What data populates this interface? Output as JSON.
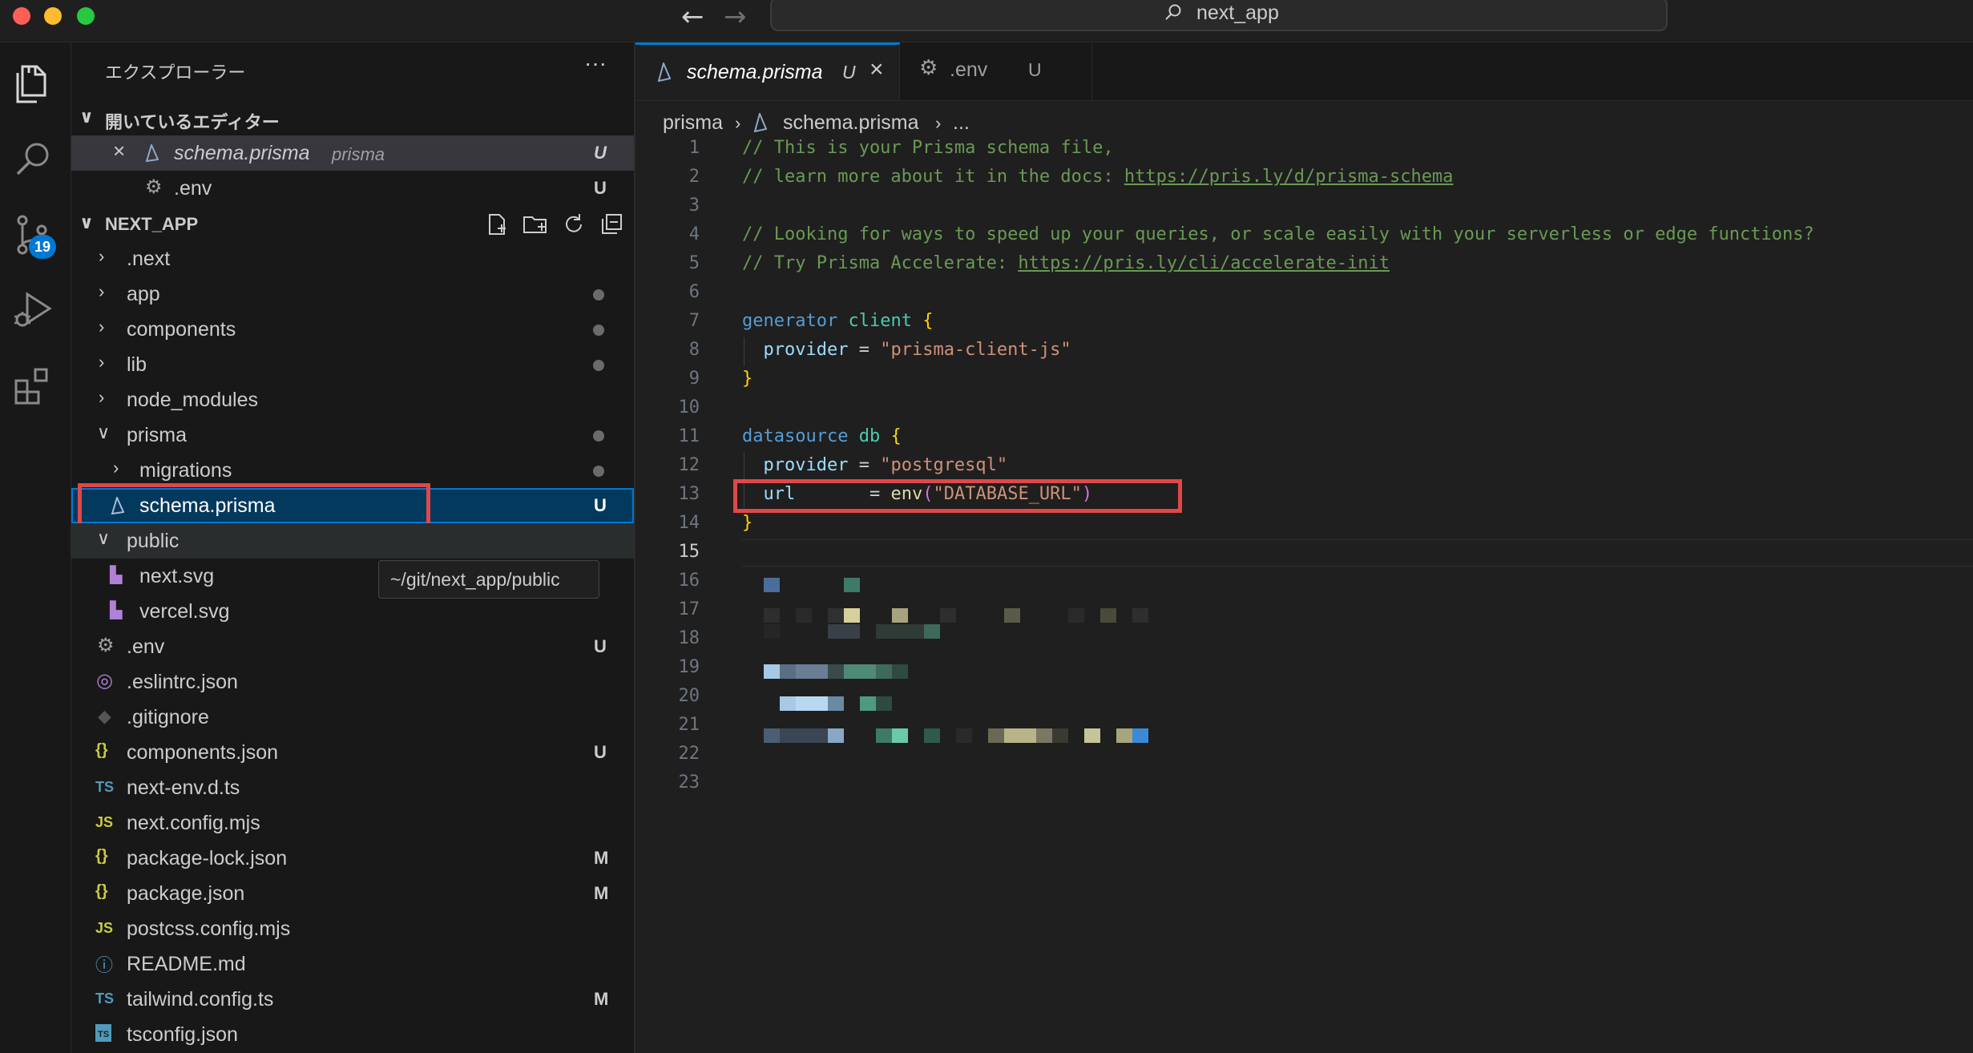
{
  "window": {
    "command_center": "next_app"
  },
  "activity_bar": {
    "scm_badge": "19"
  },
  "sidebar": {
    "title": "エクスプローラー",
    "more": "···",
    "open_editors": {
      "title": "開いているエディター",
      "items": [
        {
          "name": "schema.prisma",
          "desc": "prisma",
          "status": "U"
        },
        {
          "name": ".env",
          "status": "U"
        }
      ]
    },
    "project": {
      "title": "NEXT_APP",
      "items": [
        {
          "name": ".next"
        },
        {
          "name": "app"
        },
        {
          "name": "components"
        },
        {
          "name": "lib"
        },
        {
          "name": "node_modules"
        },
        {
          "name": "prisma"
        },
        {
          "name": "migrations"
        },
        {
          "name": "schema.prisma",
          "status": "U"
        },
        {
          "name": "public"
        },
        {
          "name": "next.svg"
        },
        {
          "name": "vercel.svg"
        },
        {
          "name": ".env",
          "status": "U"
        },
        {
          "name": ".eslintrc.json"
        },
        {
          "name": ".gitignore"
        },
        {
          "name": "components.json",
          "status": "U"
        },
        {
          "name": "next-env.d.ts",
          "icon": "TS"
        },
        {
          "name": "next.config.mjs",
          "icon": "JS"
        },
        {
          "name": "package-lock.json",
          "status": "M",
          "icon": "{}"
        },
        {
          "name": "package.json",
          "status": "M",
          "icon": "{}"
        },
        {
          "name": "postcss.config.mjs",
          "icon": "JS"
        },
        {
          "name": "README.md",
          "icon": "ⓘ"
        },
        {
          "name": "tailwind.config.ts",
          "status": "M",
          "icon": "TS"
        },
        {
          "name": "tsconfig.json",
          "icon": "TS"
        }
      ]
    },
    "tooltip": "~/git/next_app/public"
  },
  "editor": {
    "tabs": [
      {
        "name": "schema.prisma",
        "status": "U"
      },
      {
        "name": ".env",
        "status": "U"
      }
    ],
    "breadcrumb": {
      "folder": "prisma",
      "file": "schema.prisma",
      "more": "..."
    },
    "line_numbers": [
      "1",
      "2",
      "3",
      "4",
      "5",
      "6",
      "7",
      "8",
      "9",
      "10",
      "11",
      "12",
      "13",
      "14",
      "15",
      "16",
      "17",
      "18",
      "19",
      "20",
      "21",
      "22",
      "23"
    ],
    "code": {
      "l1": "// This is your Prisma schema file,",
      "l2_text": "// learn more about it in the docs: ",
      "l2_link": "https://pris.ly/d/prisma-schema",
      "l4": "// Looking for ways to speed up your queries, or scale easily with your serverless or edge functions?",
      "l5_text": "// Try Prisma Accelerate: ",
      "l5_link": "https://pris.ly/cli/accelerate-init",
      "l7_kw": "generator",
      "l7_name": "client",
      "l8_prop": "provider",
      "l8_str": "\"prisma-client-js\"",
      "l11_kw": "datasource",
      "l11_name": "db",
      "l12_prop": "provider",
      "l12_str": "\"postgresql\"",
      "l13_prop": "url",
      "l13_fn": "env",
      "l13_str": "\"DATABASE_URL\"",
      "open_brace": "{",
      "close_brace": "}",
      "equals": " = "
    }
  }
}
